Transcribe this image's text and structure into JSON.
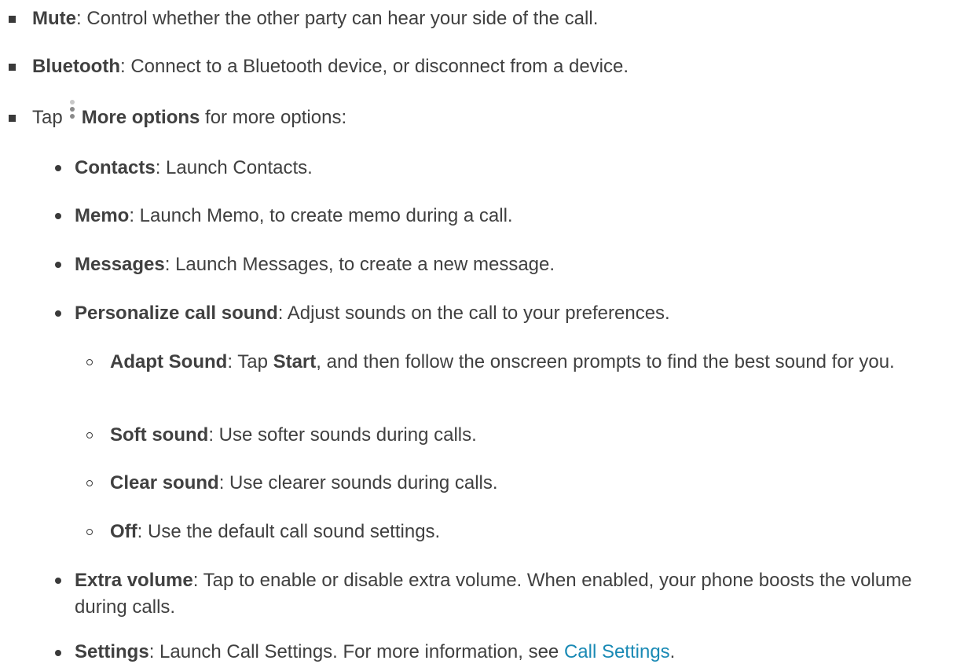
{
  "items": {
    "mute": {
      "term": "Mute",
      "text": ": Control whether the other party can hear your side of the call."
    },
    "bluetooth": {
      "term": "Bluetooth",
      "text": ": Connect to a Bluetooth device, or disconnect from a device."
    },
    "more_options": {
      "prefix": "Tap",
      "term": "More options",
      "suffix": " for more options:",
      "icon": "more-options-icon"
    },
    "contacts": {
      "term": "Contacts",
      "text": ": Launch Contacts."
    },
    "memo": {
      "term": "Memo",
      "text": ": Launch Memo, to create memo during a call."
    },
    "messages": {
      "term": "Messages",
      "text": ": Launch Messages, to create a new message."
    },
    "personalize": {
      "term": "Personalize call sound",
      "text": ": Adjust sounds on the call to your preferences."
    },
    "adapt_sound": {
      "term": "Adapt Sound",
      "text1": ": Tap ",
      "term2": "Start",
      "text2": ", and then follow the onscreen prompts to find the best sound for you."
    },
    "soft_sound": {
      "term": "Soft sound",
      "text": ": Use softer sounds during calls."
    },
    "clear_sound": {
      "term": "Clear sound",
      "text": ": Use clearer sounds during calls."
    },
    "off": {
      "term": "Off",
      "text": ": Use the default call sound settings."
    },
    "extra_volume": {
      "term": "Extra volume",
      "text": ": Tap to enable or disable extra volume. When enabled, your phone boosts the volume during calls."
    },
    "settings": {
      "term": "Settings",
      "text": ": Launch Call Settings. For more information, see ",
      "link": "Call Settings",
      "end": "."
    }
  },
  "colors": {
    "text": "#404040",
    "link": "#1a8ab5",
    "bullet": "#3a3a3a"
  }
}
